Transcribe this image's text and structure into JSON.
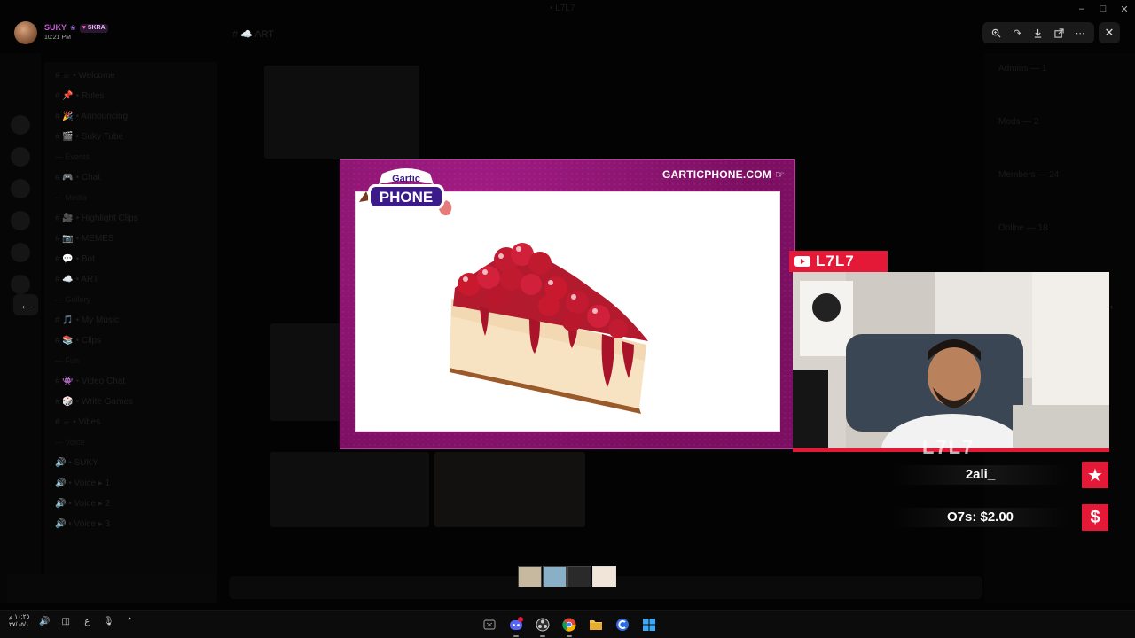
{
  "user": {
    "name": "SUKY",
    "badge_icon": "flower-icon",
    "tag": "SKRA",
    "tag_icon": "heart-icon",
    "time": "10:21 PM"
  },
  "window": {
    "title": "• L7L7",
    "controls": [
      "minimize-icon",
      "maximize-icon",
      "close-icon"
    ]
  },
  "background": {
    "channel_header": "# ☁️ ART",
    "channels": [
      {
        "label": "# ☕ • Welcome",
        "cat": false
      },
      {
        "label": "# 📌 • Rules",
        "cat": false
      },
      {
        "label": "# 🎉 • Announcing",
        "cat": false
      },
      {
        "label": "# 🎬 • Suky Tube",
        "cat": false
      },
      {
        "label": "— Events",
        "cat": true
      },
      {
        "label": "# 🎮 • Chat",
        "cat": false
      },
      {
        "label": "— Media",
        "cat": true
      },
      {
        "label": "# 🎥 • Highlight Clips",
        "cat": false
      },
      {
        "label": "# 📷 • MEMES",
        "cat": false
      },
      {
        "label": "# 💬 • Bot",
        "cat": false
      },
      {
        "label": "# ☁️ • ART",
        "cat": false
      },
      {
        "label": "— Gallery",
        "cat": true
      },
      {
        "label": "# 🎵 • My Music",
        "cat": false
      },
      {
        "label": "# 📚 • Clips",
        "cat": false
      },
      {
        "label": "— Fun",
        "cat": true
      },
      {
        "label": "# 👾 • Video Chat",
        "cat": false
      },
      {
        "label": "# 🎲 • Write Games",
        "cat": false
      },
      {
        "label": "# ☕ • Vibes",
        "cat": false
      },
      {
        "label": "— Voice",
        "cat": true
      },
      {
        "label": "🔊 • SUKY",
        "cat": false
      },
      {
        "label": "🔊 • Voice ▸ 1",
        "cat": false
      },
      {
        "label": "🔊 • Voice ▸ 2",
        "cat": false
      },
      {
        "label": "🔊 • Voice ▸ 3",
        "cat": false
      }
    ],
    "members": [
      "Admins — 1",
      "Mods — 2",
      "Members — 24",
      "Online — 18"
    ]
  },
  "viewer_toolbar": {
    "buttons": [
      "zoom-icon",
      "forward-icon",
      "download-icon",
      "open-external-icon",
      "more-icon"
    ],
    "close": "close-icon",
    "prev": "arrow-left-icon",
    "next": "arrow-right-icon"
  },
  "gartic": {
    "logo_top": "Gartic",
    "logo_bottom": "PHONE",
    "url": "GARTICPHONE.COM",
    "url_icon": "cursor-hand-icon",
    "drawing": "cherry-cheesecake-drawing",
    "frame_color": "#8a1470"
  },
  "webcam": {
    "channel_name": "L7L7",
    "platform_icon": "youtube-icon",
    "watermark": "L7L7",
    "accent": "#e31937"
  },
  "alerts": [
    {
      "text": "2ali_",
      "icon": "star-icon",
      "glyph": "★"
    },
    {
      "text": "O7s: $2.00",
      "icon": "dollar-icon",
      "glyph": "$"
    }
  ],
  "taskbar": {
    "clock_time": "١٠:٢٥ م",
    "clock_date": "٢٧/٠٥/١",
    "lang": "ع",
    "apps": [
      "xbox-icon",
      "discord-icon",
      "obs-icon",
      "chrome-icon",
      "folder-icon",
      "ccleaner-icon",
      "windows-icon"
    ]
  }
}
